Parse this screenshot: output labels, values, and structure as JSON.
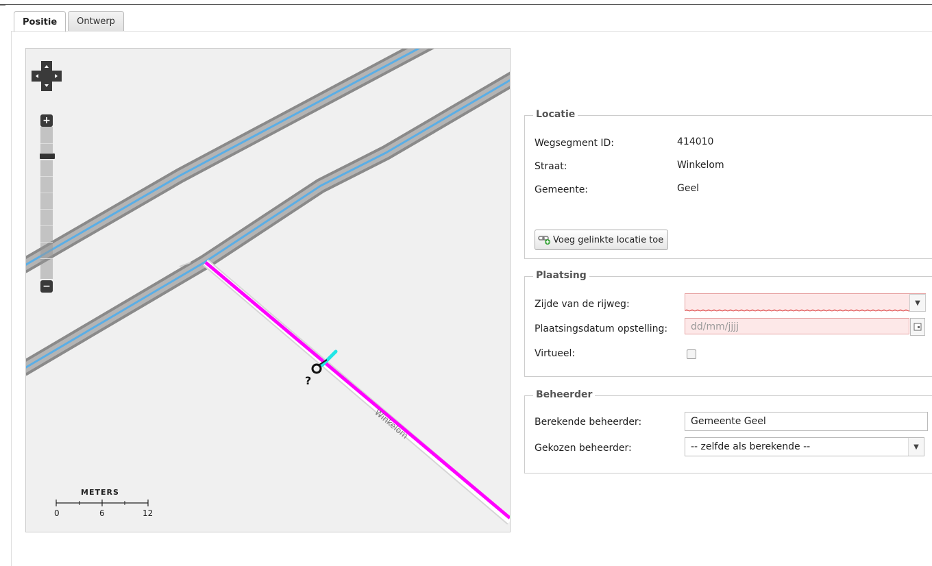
{
  "tabs": [
    {
      "label": "Positie",
      "active": true
    },
    {
      "label": "Ontwerp",
      "active": false
    }
  ],
  "map": {
    "street_label": "Winkelom",
    "marker_label": "?",
    "scale": {
      "title": "METERS",
      "ticks": [
        "0",
        "6",
        "12"
      ]
    },
    "colors": {
      "road_casing": "#8a8a8a",
      "road_center": "#5aaee6",
      "selected_segment": "#ff00ff",
      "map_bg": "#f0f0f0"
    }
  },
  "locatie": {
    "legend": "Locatie",
    "fields": [
      {
        "label": "Wegsegment ID:",
        "value": "414010"
      },
      {
        "label": "Straat:",
        "value": "Winkelom"
      },
      {
        "label": "Gemeente:",
        "value": "Geel"
      }
    ],
    "add_button_label": "Voeg gelinkte locatie toe"
  },
  "plaatsing": {
    "legend": "Plaatsing",
    "side_label": "Zijde van de rijweg:",
    "side_value": "",
    "date_label": "Plaatsingsdatum opstelling:",
    "date_placeholder": "dd/mm/jjjj",
    "virtual_label": "Virtueel:",
    "virtual_checked": false
  },
  "beheerder": {
    "legend": "Beheerder",
    "computed_label": "Berekende beheerder:",
    "computed_value": "Gemeente Geel",
    "chosen_label": "Gekozen beheerder:",
    "chosen_value": "-- zelfde als berekende --"
  }
}
